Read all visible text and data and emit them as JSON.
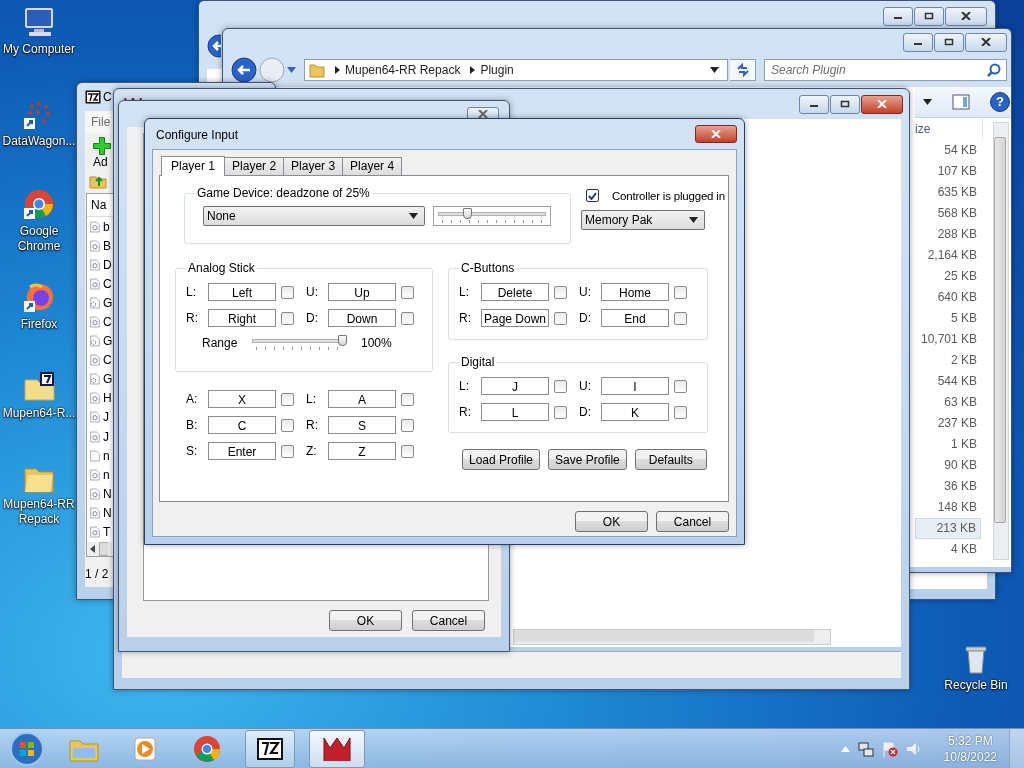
{
  "desktop_icons": [
    {
      "label": "My Computer",
      "kind": "computer"
    },
    {
      "label": "DataWagon...",
      "kind": "dots"
    },
    {
      "label": "Google Chrome",
      "kind": "chrome"
    },
    {
      "label": "Firefox",
      "kind": "firefox"
    },
    {
      "label": "Mupen64-R...",
      "kind": "archive"
    },
    {
      "label": "Mupen64-RR Repack",
      "kind": "folder"
    }
  ],
  "recycle_bin": {
    "label": "Recycle Bin"
  },
  "explorer": {
    "help": "?",
    "breadcrumb": [
      "Mupen64-RR Repack",
      "Plugin"
    ],
    "search": {
      "placeholder": "Search Plugin"
    },
    "size_column": "ize",
    "sizes": [
      {
        "text": "54 KB",
        "selected": false
      },
      {
        "text": "107 KB",
        "selected": false
      },
      {
        "text": "635 KB",
        "selected": false
      },
      {
        "text": "568 KB",
        "selected": false
      },
      {
        "text": "288 KB",
        "selected": false
      },
      {
        "text": "2,164 KB",
        "selected": false
      },
      {
        "text": "25 KB",
        "selected": false
      },
      {
        "text": "640 KB",
        "selected": false
      },
      {
        "text": "5 KB",
        "selected": false
      },
      {
        "text": "10,701 KB",
        "selected": false
      },
      {
        "text": "2 KB",
        "selected": false
      },
      {
        "text": "544 KB",
        "selected": false
      },
      {
        "text": "63 KB",
        "selected": false
      },
      {
        "text": "237 KB",
        "selected": false
      },
      {
        "text": "1 KB",
        "selected": false
      },
      {
        "text": "90 KB",
        "selected": false
      },
      {
        "text": "36 KB",
        "selected": false
      },
      {
        "text": "148 KB",
        "selected": false
      },
      {
        "text": "213 KB",
        "selected": true
      },
      {
        "text": "4 KB",
        "selected": false
      }
    ]
  },
  "archiver": {
    "title": "C",
    "menu": "File",
    "add_button": "Ad",
    "name_column": "Na",
    "status": "1 / 2",
    "rows": [
      {
        "text": "b",
        "kind": "link"
      },
      {
        "text": "B",
        "kind": "link"
      },
      {
        "text": "D",
        "kind": "link"
      },
      {
        "text": "C",
        "kind": "link"
      },
      {
        "text": "G",
        "kind": "gear"
      },
      {
        "text": "C",
        "kind": "link"
      },
      {
        "text": "G",
        "kind": "gear"
      },
      {
        "text": "C",
        "kind": "link"
      },
      {
        "text": "G",
        "kind": "gear"
      },
      {
        "text": "H",
        "kind": "link"
      },
      {
        "text": "J",
        "kind": "link"
      },
      {
        "text": "J",
        "kind": "link"
      },
      {
        "text": "n",
        "kind": "blank"
      },
      {
        "text": "n",
        "kind": "link"
      },
      {
        "text": "N",
        "kind": "link"
      },
      {
        "text": "N",
        "kind": "link"
      },
      {
        "text": "T",
        "kind": "link"
      }
    ]
  },
  "settings": {
    "buttons": [
      "OK",
      "Cancel"
    ]
  },
  "dialog": {
    "title": "Configure Input",
    "tabs": [
      {
        "label": "Player 1",
        "selected": true
      },
      {
        "label": "Player 2",
        "selected": false
      },
      {
        "label": "Player 3",
        "selected": false
      },
      {
        "label": "Player 4",
        "selected": false
      }
    ],
    "device": {
      "title": "Game Device: deadzone of 25%",
      "value": "None",
      "deadzone": {
        "level": 0.25
      },
      "plugged_in": {
        "label": "Controller is plugged in",
        "checked": true
      },
      "pak": "Memory Pak"
    },
    "analog": {
      "title": "Analog Stick",
      "keys": [
        {
          "label": "L:",
          "value": "Left",
          "checked": false
        },
        {
          "label": "U:",
          "value": "Up",
          "checked": false
        },
        {
          "label": "R:",
          "value": "Right",
          "checked": false
        },
        {
          "label": "D:",
          "value": "Down",
          "checked": false
        }
      ],
      "range": {
        "label": "Range",
        "level": 1,
        "reading": "100%"
      }
    },
    "buttons_keys": [
      {
        "label": "A:",
        "value": "X",
        "checked": false
      },
      {
        "label": "L:",
        "value": "A",
        "checked": false
      },
      {
        "label": "B:",
        "value": "C",
        "checked": false
      },
      {
        "label": "R:",
        "value": "S",
        "checked": false
      },
      {
        "label": "S:",
        "value": "Enter",
        "checked": false
      },
      {
        "label": "Z:",
        "value": "Z",
        "checked": false
      }
    ],
    "c_buttons": {
      "title": "C-Buttons",
      "keys": [
        {
          "label": "L:",
          "value": "Delete",
          "checked": false
        },
        {
          "label": "U:",
          "value": "Home",
          "checked": false
        },
        {
          "label": "R:",
          "value": "Page Down",
          "checked": false
        },
        {
          "label": "D:",
          "value": "End",
          "checked": false
        }
      ]
    },
    "digital": {
      "title": "Digital",
      "keys": [
        {
          "label": "L:",
          "value": "J",
          "checked": false
        },
        {
          "label": "U:",
          "value": "I",
          "checked": false
        },
        {
          "label": "R:",
          "value": "L",
          "checked": false
        },
        {
          "label": "D:",
          "value": "K",
          "checked": false
        }
      ]
    },
    "profile_buttons": [
      "Load Profile",
      "Save Profile",
      "Defaults"
    ],
    "buttons": [
      "OK",
      "Cancel"
    ]
  },
  "taskbar": {
    "time": "5:32 PM",
    "date": "10/8/2022"
  }
}
